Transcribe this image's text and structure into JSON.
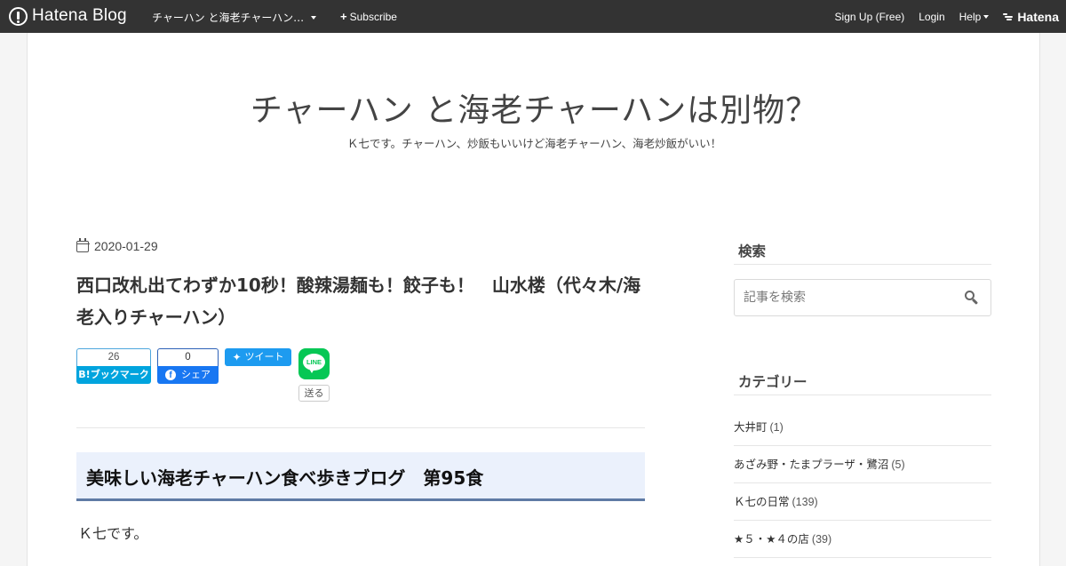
{
  "header": {
    "logo_text": "Hatena Blog",
    "blog_name": "チャーハン と海老チャーハン…",
    "subscribe_label": "Subscribe",
    "signup_label": "Sign Up (Free)",
    "login_label": "Login",
    "help_label": "Help",
    "hatena_label": "Hatena"
  },
  "blog": {
    "title": "チャーハン と海老チャーハンは別物？",
    "description": "Ｋ七です。チャーハン、炒飯もいいけど海老チャーハン、海老炒飯がいい！"
  },
  "entry": {
    "date": "2020-01-29",
    "title": "西口改札出てわずか10秒！酸辣湯麺も！餃子も！　山水楼（代々木/海老入りチャーハン）",
    "subheading": "美味しい海老チャーハン食べ歩きブログ　第95食",
    "body_first_line": "Ｋ七です。"
  },
  "social": {
    "hatebu_count": "26",
    "hatebu_label": "B!ブックマーク",
    "facebook_count": "0",
    "facebook_label": "シェア",
    "twitter_label": "ツイート",
    "line_icon_text": "LINE",
    "line_label": "送る"
  },
  "sidebar": {
    "search_title": "検索",
    "search_placeholder": "記事を検索",
    "category_title": "カテゴリー",
    "categories": [
      {
        "name": "大井町",
        "count": "(1)"
      },
      {
        "name": "あざみ野・たまプラーザ・鷺沼",
        "count": "(5)"
      },
      {
        "name": "Ｋ七の日常",
        "count": "(139)"
      },
      {
        "name": "★５・★４の店",
        "count": "(39)"
      }
    ]
  },
  "colors": {
    "header_bg": "#333333",
    "hatebu_blue": "#00a4de",
    "facebook_blue": "#1877f2",
    "twitter_blue": "#1d9bf0",
    "line_green": "#06c755",
    "subheading_bg": "#ebf1fc",
    "subheading_border": "#5f7ba5"
  },
  "icons": {
    "logo": "hatena-blog-logo-icon",
    "calendar": "calendar-icon",
    "search": "search-icon"
  }
}
